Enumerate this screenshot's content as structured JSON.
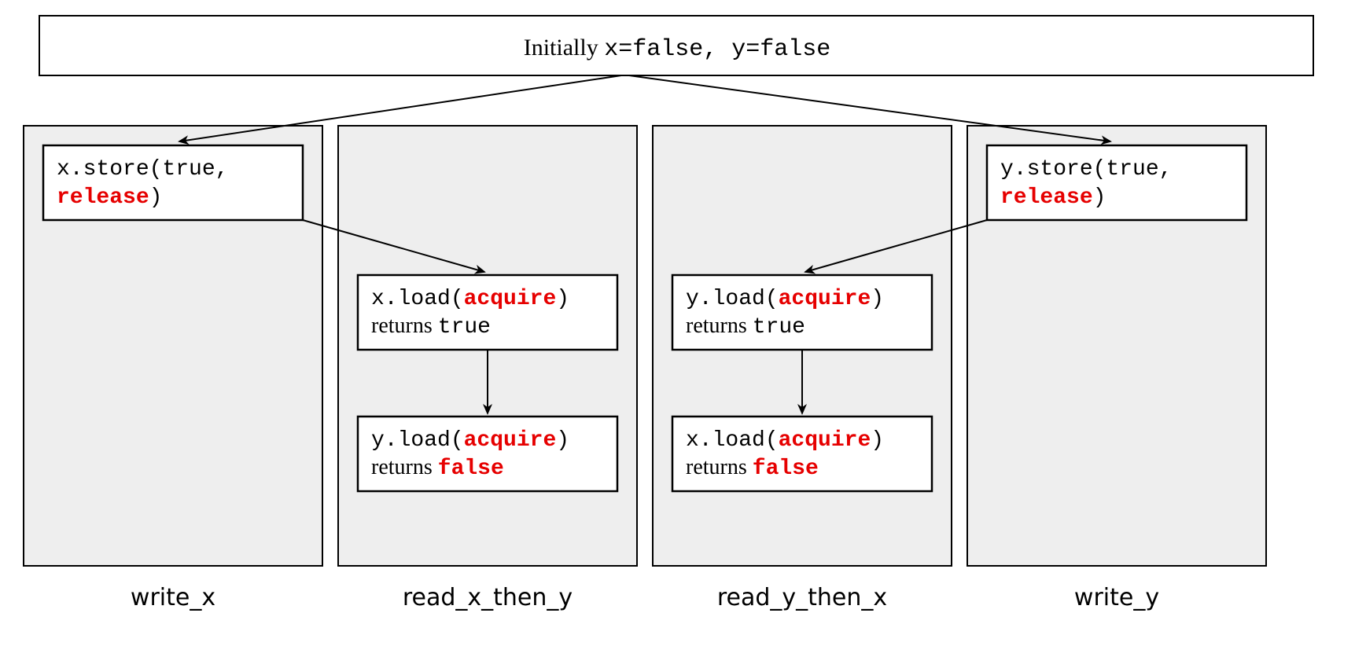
{
  "initial": {
    "lead": "Initially ",
    "vars": "x=false, y=false"
  },
  "threads": {
    "write_x": {
      "label": "write_x",
      "op1": {
        "line1_pre": "x.store(true,",
        "line2_red": "release",
        "line2_post": ")"
      }
    },
    "read_x_then_y": {
      "label": "read_x_then_y",
      "op1": {
        "line1_pre": "x.load(",
        "line1_red": "acquire",
        "line1_post": ")",
        "line2_pre": "returns ",
        "line2_mono": "true"
      },
      "op2": {
        "line1_pre": "y.load(",
        "line1_red": "acquire",
        "line1_post": ")",
        "line2_pre": "returns ",
        "line2_red": "false"
      }
    },
    "read_y_then_x": {
      "label": "read_y_then_x",
      "op1": {
        "line1_pre": "y.load(",
        "line1_red": "acquire",
        "line1_post": ")",
        "line2_pre": "returns ",
        "line2_mono": "true"
      },
      "op2": {
        "line1_pre": "x.load(",
        "line1_red": "acquire",
        "line1_post": ")",
        "line2_pre": "returns ",
        "line2_red": "false"
      }
    },
    "write_y": {
      "label": "write_y",
      "op1": {
        "line1_pre": "y.store(true,",
        "line2_red": "release",
        "line2_post": ")"
      }
    }
  }
}
